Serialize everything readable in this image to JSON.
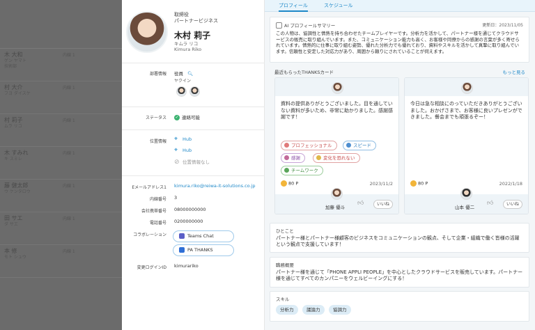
{
  "background_list": {
    "rows": [
      {
        "name": "木 大和",
        "sub": "ゲン ヤマト",
        "dept": "技術部",
        "phone": "内線 1"
      },
      {
        "name": "村 大介",
        "sub": "フヨ ダイスケ",
        "dept": "",
        "phone": "内線 1"
      },
      {
        "name": "村 莉子",
        "sub": "ムラ リコ",
        "dept": "",
        "phone": "内線 1"
      },
      {
        "name": "木 すみれ",
        "sub": "キ スミレ",
        "dept": "",
        "phone": "内線 1"
      },
      {
        "name": "藤 健太郎",
        "sub": "ウ ケンタロウ",
        "dept": "",
        "phone": "内線 1"
      },
      {
        "name": "田 サエ",
        "sub": "ダ サエ",
        "dept": "",
        "phone": "内線 1"
      },
      {
        "name": "本 修",
        "sub": "モト シュウ",
        "dept": "",
        "phone": "内線 1"
      }
    ]
  },
  "profile": {
    "role_line1": "取締役",
    "role_line2": "パートナービジネス",
    "name": "木村 莉子",
    "kana": "キムラ リコ",
    "romaji": "Kimura Riko",
    "dept_label": "部署情報",
    "dept_value": "役員",
    "dept_sub": "ヤクイン",
    "status_label": "ステータス",
    "status_value": "連絡可能",
    "location_label": "位置情報",
    "hub1": "Hub",
    "hub2": "Hub",
    "hub_none": "位置情報なし",
    "email_label": "Eメールアドレス1",
    "email_value": "kimura.riko@reiwa-it-solutions.co.jp",
    "ext_label": "内線番号",
    "ext_value": "3",
    "mobile_label": "会社携帯番号",
    "mobile_value": "08000000000",
    "phone_label": "電話番号",
    "phone_value": "0200000000",
    "collab_label": "コラボレーション",
    "collab_teams": "Teams Chat",
    "collab_pa": "PA THANKS",
    "login_label": "変更ログインID",
    "login_value": "kimurariko"
  },
  "tabs": {
    "profile": "プロフィール",
    "schedule": "スケジュール"
  },
  "ai_summary": {
    "title": "AI プロフィールサマリー",
    "updated": "更新日：2023/11/05",
    "text": "この人物は、協調性と情熱を持ち合わせたチームプレイヤーです。分析力を活かして、パートナー様を通じてクラウドサービスの販売に取り組んでいます。また、コミュニケーション能力も高く、お客様や同僚からの感謝の言葉が多く寄せられています。情熱的に仕事に取り組む姿勢、優れた分析力でも優れており、資料やスキルを活かして真摯に取り組んでいます。信頼性と安定した対応力があり、周囲から頼りにされていることが伺えます。"
  },
  "thanks": {
    "title": "最近もらったTHANKSカード",
    "more": "もっと見る",
    "cards": [
      {
        "message": "資料の提供ありがとうございました。目を通していない資料が多いため、非常に助かりました。感謝感謝です！",
        "tags": [
          "プロフェッショナル",
          "スピード",
          "感謝",
          "変化を恐れない",
          "チームワーク"
        ],
        "points": "80 P",
        "date": "2023/11/2",
        "from": "加藤 優斗",
        "like": "いいね"
      },
      {
        "message": "今日は急な相談にのっていただきありがとうございました。おかげさまで、お客様に良いプレゼンができました。餐会までも頑張るぞー！",
        "tags": [],
        "points": "80 P",
        "date": "2022/1/18",
        "from": "山本 優二",
        "like": "いいね"
      }
    ]
  },
  "hitokoto": {
    "title": "ひとこと",
    "text": "パートナー様とパートナー様顧客のビジネスをコミュニケーションの観点、そして企業・組織で働く皆様の活躍という観点で支援しています！"
  },
  "duties": {
    "title": "職務概要",
    "text": "パートナー様を通じて「PHONE APPLI PEOPLE」を中心としたクラウドサービスを販売しています。パートナー様を通じてすべてのカンパニーをウェルビーイングにする！"
  },
  "skills": {
    "title": "スキル",
    "items": [
      "分析力",
      "議論力",
      "協調力"
    ]
  }
}
